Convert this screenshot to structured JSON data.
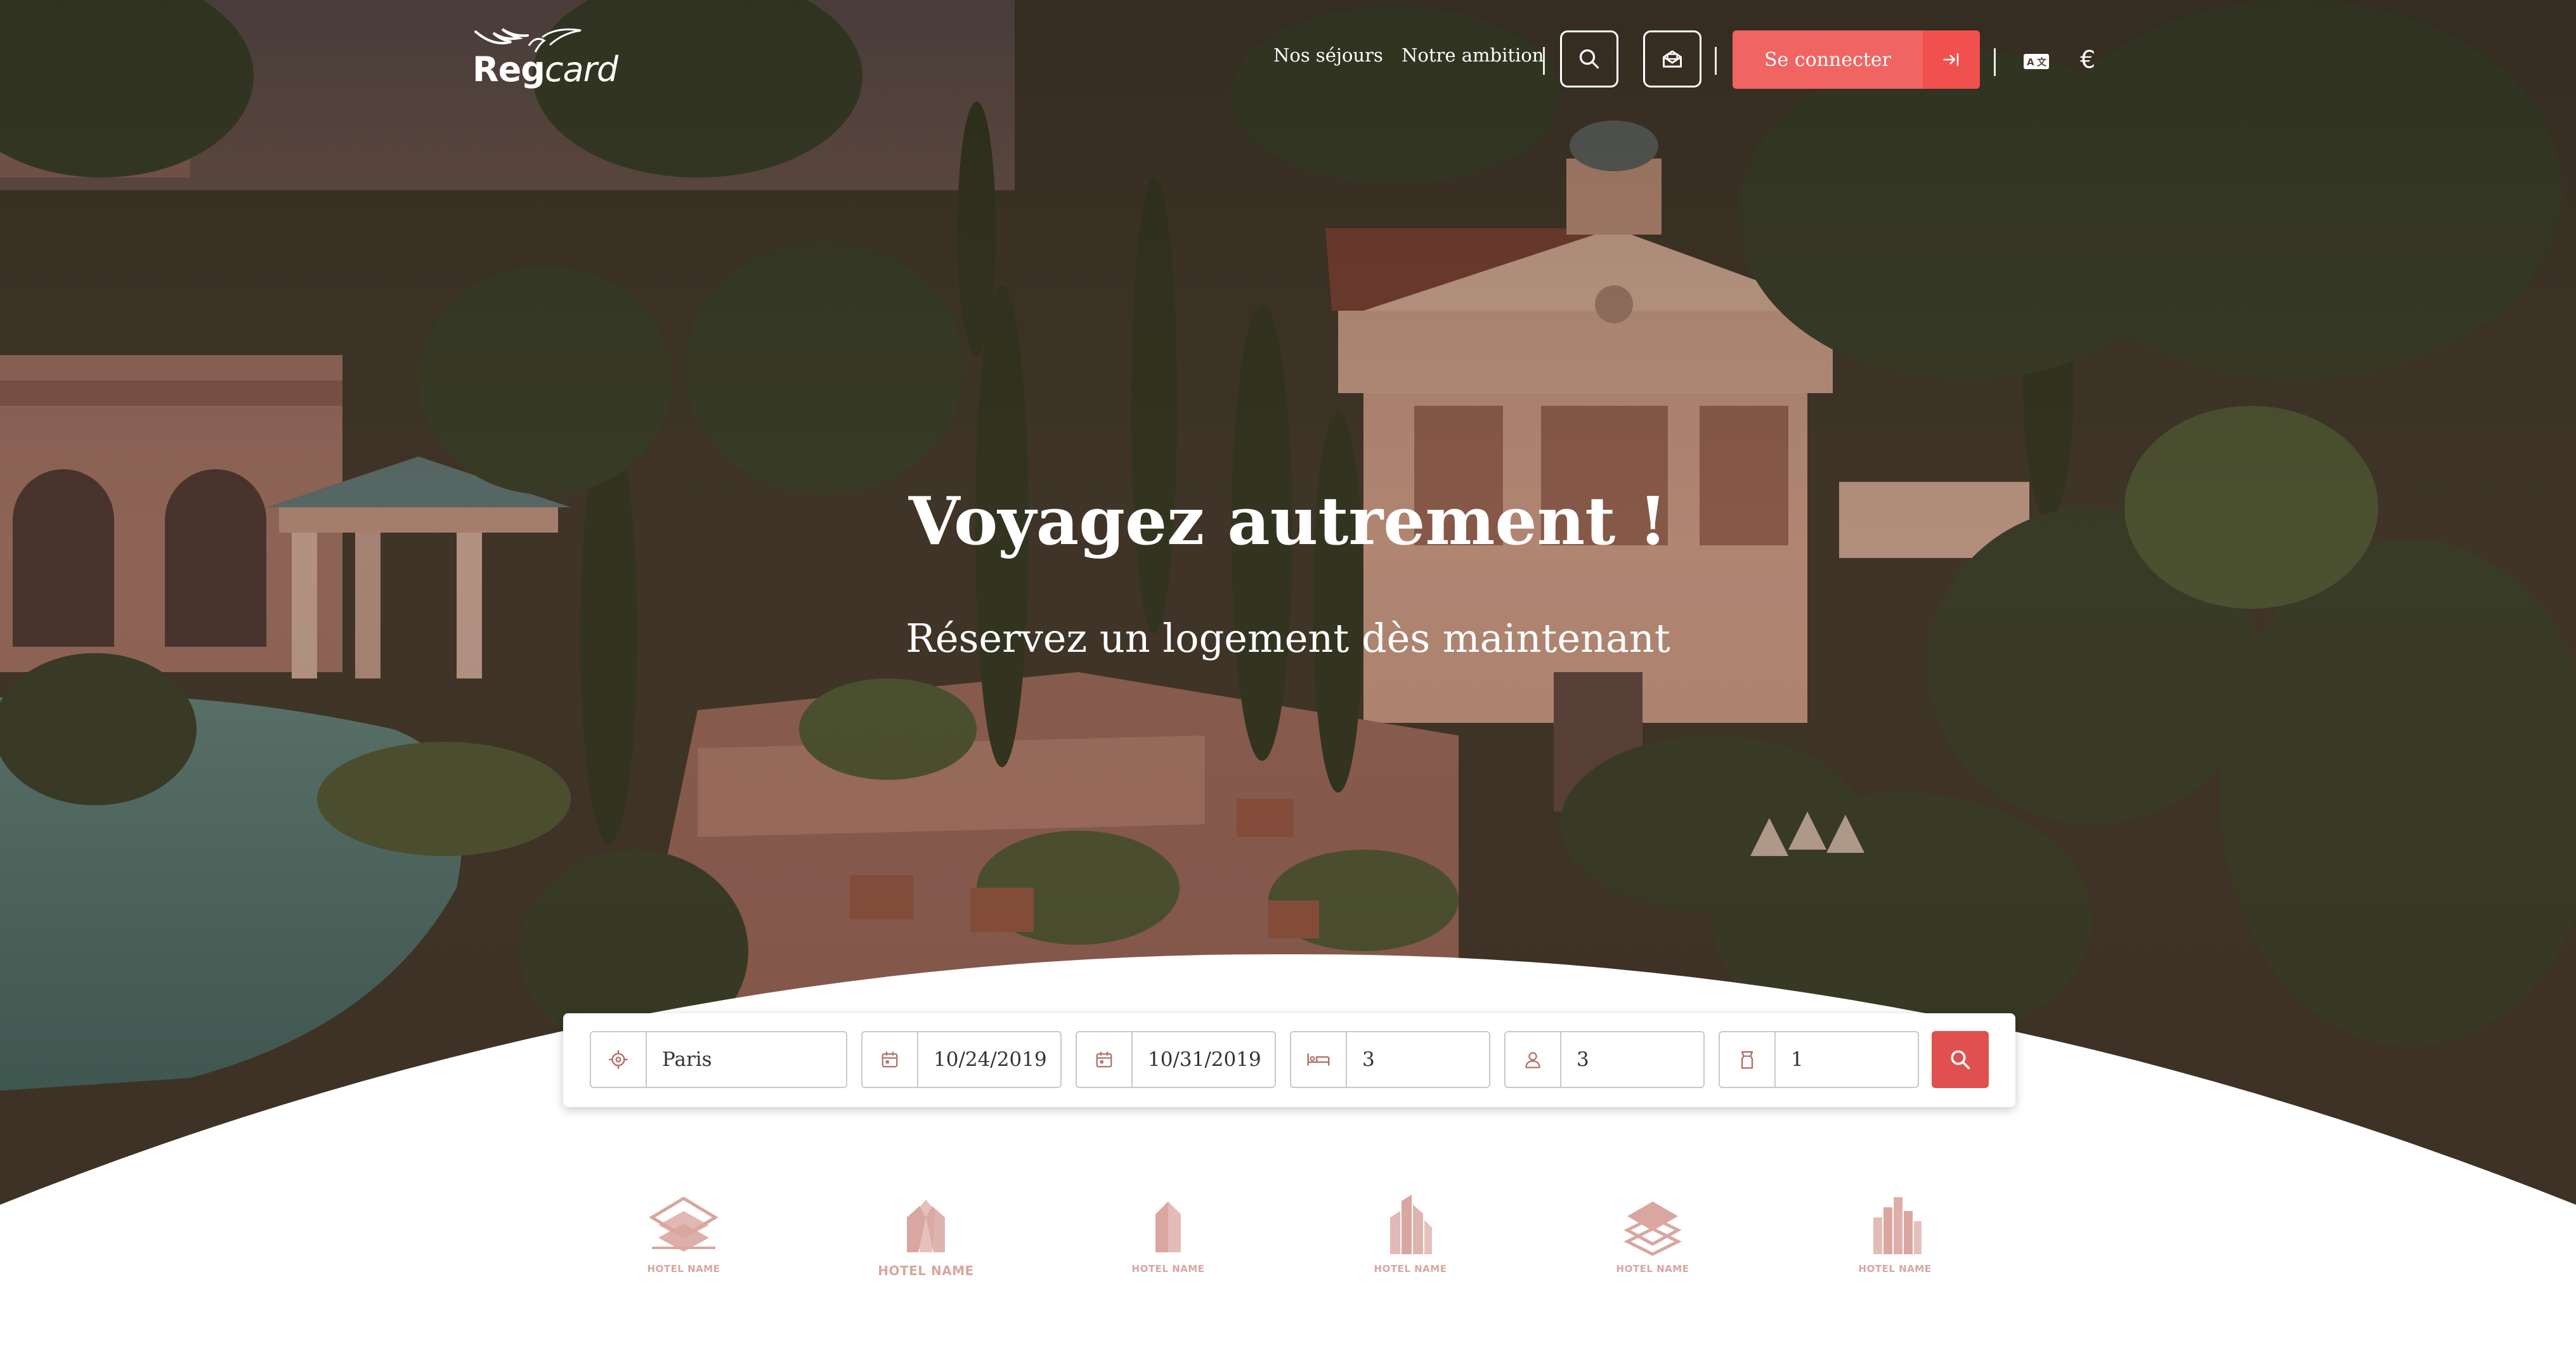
{
  "brand": {
    "logo_text_bold": "Reg",
    "logo_text_light": "card"
  },
  "nav": {
    "stays": "Nos séjours",
    "ambition": "Notre ambition",
    "login": "Se connecter",
    "currency": "€"
  },
  "hero": {
    "title": "Voyagez autrement !",
    "subtitle": "Réservez un logement dès maintenant"
  },
  "search": {
    "destination": "Paris",
    "checkin": "10/24/2019",
    "checkout": "10/31/2019",
    "beds": "3",
    "guests": "3",
    "rooms": "1"
  },
  "partners": [
    {
      "name": "HOTEL NAME"
    },
    {
      "name": "HOTEL NAME"
    },
    {
      "name": "HOTEL NAME"
    },
    {
      "name": "HOTEL NAME"
    },
    {
      "name": "HOTEL NAME"
    },
    {
      "name": "HOTEL NAME"
    }
  ],
  "colors": {
    "accent": "#f06462",
    "accent_dark": "#e0504f",
    "partner_logo": "#d9a6a0"
  },
  "icons": {
    "search": "search-icon",
    "mail": "mail-icon",
    "login_arrow": "login-arrow-icon",
    "language": "language-icon",
    "location": "location-icon",
    "calendar": "calendar-icon",
    "bed": "bed-icon",
    "person": "person-icon",
    "room": "room-icon"
  }
}
